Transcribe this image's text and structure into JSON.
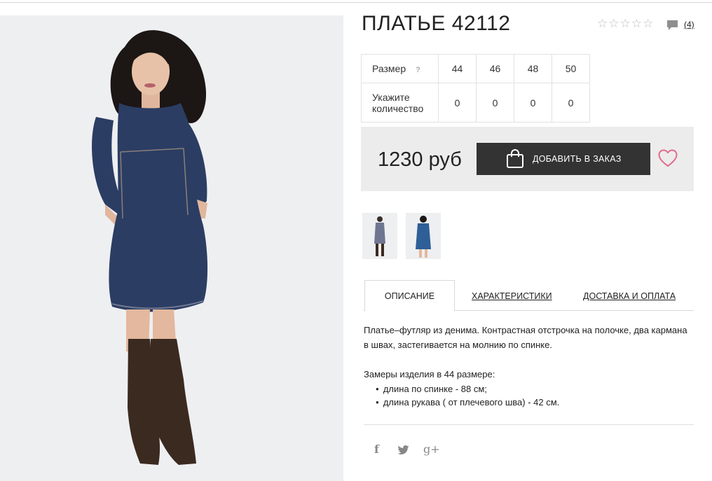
{
  "product": {
    "title": "ПЛАТЬЕ 42112",
    "review_count": "(4)",
    "rating_icons": [
      "star-outline",
      "star-outline",
      "star-outline",
      "star-outline",
      "star-outline"
    ]
  },
  "sizes": {
    "size_label": "Размер",
    "help_mark": "?",
    "qty_label": "Укажите количество",
    "items": [
      {
        "size": "44",
        "qty": "0"
      },
      {
        "size": "46",
        "qty": "0"
      },
      {
        "size": "48",
        "qty": "0"
      },
      {
        "size": "50",
        "qty": "0"
      }
    ]
  },
  "purchase": {
    "price": "1230 руб",
    "add_label": "ДОБАВИТЬ В ЗАКАЗ",
    "heart_color": "#e36b8c"
  },
  "tabs": {
    "description": "ОПИСАНИЕ",
    "characteristics": "ХАРАКТЕРИСТИКИ",
    "delivery": "ДОСТАВКА И ОПЛАТА"
  },
  "description": {
    "text": "Платье–футляр из денима. Контрастная отстрочка на полочке, два кармана в швах, застегивается на молнию по спинке.",
    "measure_title": "Замеры изделия в 44 размере:",
    "measures": [
      "длина по спинке - 88 см;",
      "длина рукава ( от плечевого шва) - 42 см."
    ]
  },
  "social": {
    "facebook": "f",
    "google": "g+"
  },
  "colors": {
    "button_bg": "#333333",
    "price_box_bg": "#ececec",
    "dress": "#2b3d63"
  }
}
